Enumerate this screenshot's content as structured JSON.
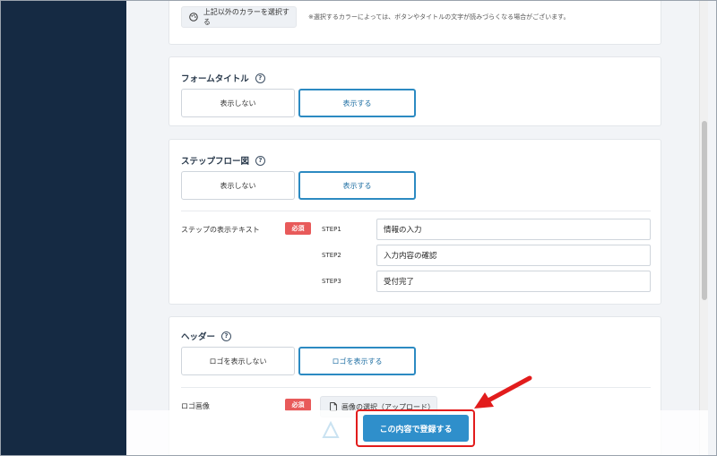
{
  "colors": {
    "sidebar": "#152a43",
    "accent": "#2c8ac2",
    "required": "#e85a5a",
    "submit": "#2f8fcb",
    "callout": "#e21c1c"
  },
  "swatches": [
    "#3b86c6",
    "#2f9a6e",
    "#e0833a",
    "#e25c62",
    "#8e4fb8",
    "#2d4a7a",
    "#5c5c5c",
    "#34465c"
  ],
  "color_section": {
    "custom_color_button": "上記以外のカラーを選択する",
    "custom_color_icon": "palette-icon",
    "note": "※選択するカラーによっては、ボタンやタイトルの文字が読みづらくなる場合がございます。"
  },
  "form_title": {
    "title": "フォームタイトル",
    "help_icon": "question-circle-icon",
    "help_glyph": "?",
    "option_hide": "表示しない",
    "option_show": "表示する",
    "selected": "表示する"
  },
  "step_flow": {
    "title": "ステップフロー図",
    "help_icon": "question-circle-icon",
    "help_glyph": "?",
    "option_hide": "表示しない",
    "option_show": "表示する",
    "selected": "表示する",
    "text_label": "ステップの表示テキスト",
    "required_badge": "必須",
    "steps": [
      {
        "label": "STEP1",
        "value": "情報の入力"
      },
      {
        "label": "STEP2",
        "value": "入力内容の確認"
      },
      {
        "label": "STEP3",
        "value": "受付完了"
      }
    ]
  },
  "header": {
    "title": "ヘッダー",
    "help_icon": "question-circle-icon",
    "help_glyph": "?",
    "option_hide": "ロゴを表示しない",
    "option_show": "ロゴを表示する",
    "selected": "ロゴを表示する",
    "logo_label": "ロゴ画像",
    "required_badge": "必須",
    "upload_button": "画像の選択（アップロード）",
    "upload_icon": "file-icon"
  },
  "footer": {
    "submit_button": "この内容で登録する",
    "watermark_icon": "logo-icon"
  }
}
